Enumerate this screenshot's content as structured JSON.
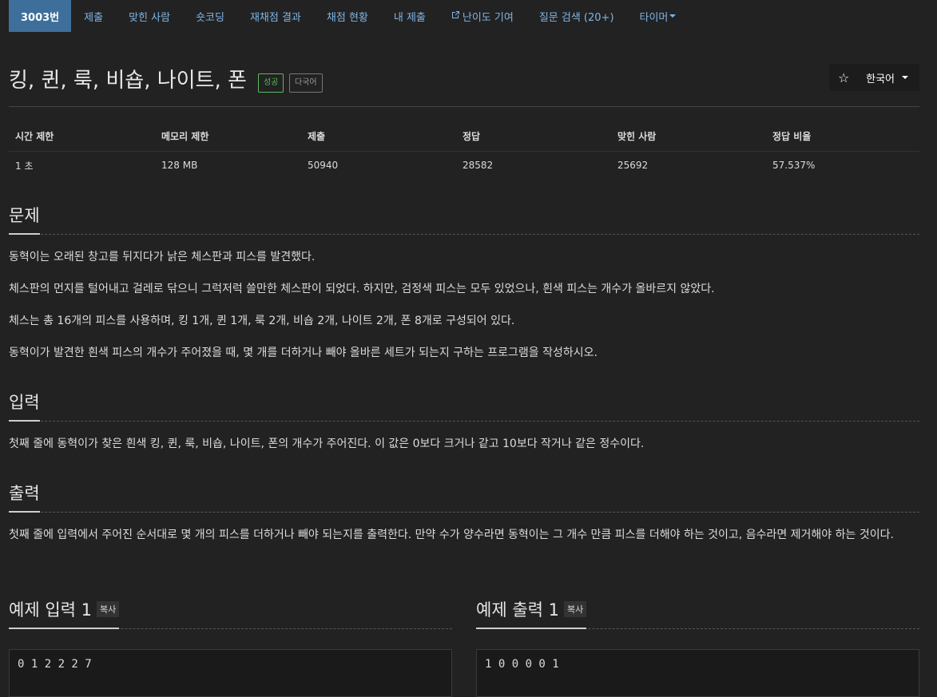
{
  "nav": {
    "items": [
      {
        "label": "3003번"
      },
      {
        "label": "제출"
      },
      {
        "label": "맞힌 사람"
      },
      {
        "label": "숏코딩"
      },
      {
        "label": "재채점 결과"
      },
      {
        "label": "채점 현황"
      },
      {
        "label": "내 제출"
      },
      {
        "label": "난이도 기여",
        "icon": "external-link-icon"
      },
      {
        "label": "질문 검색 (20+)"
      },
      {
        "label": "타이머"
      }
    ]
  },
  "problem": {
    "title": "킹, 퀸, 룩, 비숍, 나이트, 폰",
    "badge_success": "성공",
    "badge_lang": "다국어"
  },
  "toolbar": {
    "star_icon": "☆",
    "language": "한국어"
  },
  "info": {
    "headers": [
      "시간 제한",
      "메모리 제한",
      "제출",
      "정답",
      "맞힌 사람",
      "정답 비율"
    ],
    "values": [
      "1 초",
      "128 MB",
      "50940",
      "28582",
      "25692",
      "57.537%"
    ]
  },
  "sections": {
    "problem": {
      "heading": "문제",
      "paragraphs": [
        "동혁이는 오래된 창고를 뒤지다가 낡은 체스판과 피스를 발견했다.",
        "체스판의 먼지를 털어내고 걸레로 닦으니 그럭저럭 쓸만한 체스판이 되었다. 하지만, 검정색 피스는 모두 있었으나, 흰색 피스는 개수가 올바르지 않았다.",
        "체스는 총 16개의 피스를 사용하며, 킹 1개, 퀸 1개, 룩 2개, 비숍 2개, 나이트 2개, 폰 8개로 구성되어 있다.",
        "동혁이가 발견한 흰색 피스의 개수가 주어졌을 때, 몇 개를 더하거나 빼야 올바른 세트가 되는지 구하는 프로그램을 작성하시오."
      ]
    },
    "input": {
      "heading": "입력",
      "paragraphs": [
        "첫째 줄에 동혁이가 찾은 흰색 킹, 퀸, 룩, 비숍, 나이트, 폰의 개수가 주어진다. 이 값은 0보다 크거나 같고 10보다 작거나 같은 정수이다."
      ]
    },
    "output": {
      "heading": "출력",
      "paragraphs": [
        "첫째 줄에 입력에서 주어진 순서대로 몇 개의 피스를 더하거나 빼야 되는지를 출력한다. 만약 수가 양수라면 동혁이는 그 개수 만큼 피스를 더해야 하는 것이고, 음수라면 제거해야 하는 것이다."
      ]
    }
  },
  "samples": {
    "input": {
      "heading": "예제 입력 1",
      "copy": "복사",
      "content": "0 1 2 2 2 7"
    },
    "output": {
      "heading": "예제 출력 1",
      "copy": "복사",
      "content": "1 0 0 0 0 1"
    }
  }
}
